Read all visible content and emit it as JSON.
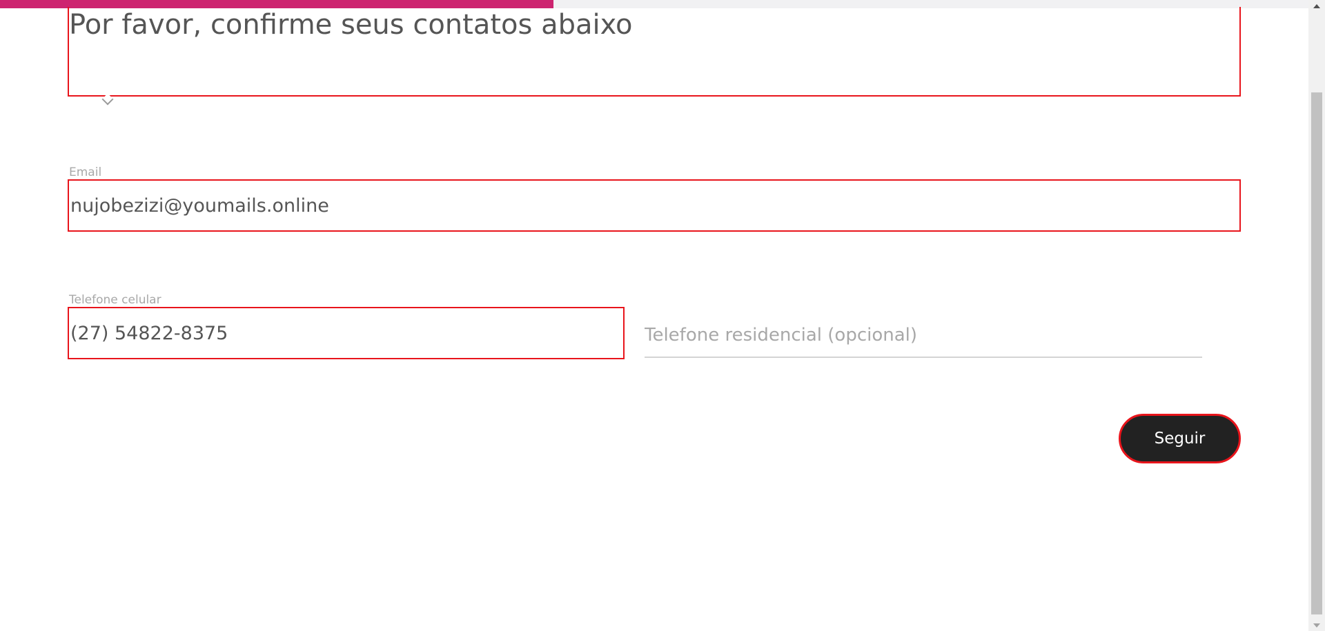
{
  "progress": {
    "percent": 42.3,
    "color": "#cd2470"
  },
  "heading": {
    "text": "Por favor, confirme seus contatos abaixo"
  },
  "email": {
    "label": "Email",
    "value": "nujobezizi@youmails.online"
  },
  "mobile_phone": {
    "label": "Telefone celular",
    "value": "(27) 54822-8375"
  },
  "home_phone": {
    "placeholder": "Telefone residencial (opcional)",
    "value": ""
  },
  "submit": {
    "label": "Seguir"
  },
  "colors": {
    "error_border": "#e8141b",
    "button_bg": "#222222",
    "text": "#555555",
    "muted": "#a8a8a8"
  }
}
